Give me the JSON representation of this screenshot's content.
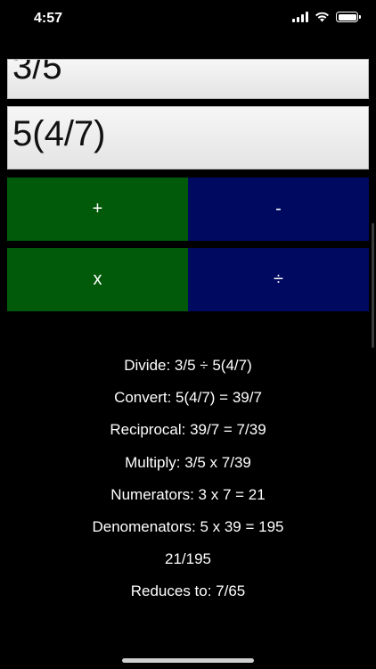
{
  "status_bar": {
    "time": "4:57",
    "icons": [
      "signal-icon",
      "wifi-icon",
      "battery-icon"
    ]
  },
  "inputs": {
    "first_fraction": "3/5",
    "second_fraction": "5(4/7)"
  },
  "operations": {
    "add": "+",
    "subtract": "-",
    "multiply": "x",
    "divide": "÷"
  },
  "steps": [
    "Divide: 3/5 ÷ 5(4/7)",
    "Convert: 5(4/7) = 39/7",
    "Reciprocal: 39/7 = 7/39",
    "Multiply: 3/5 x 7/39",
    "Numerators: 3 x 7 = 21",
    "Denomenators: 5 x 39 = 195",
    "21/195",
    "Reduces to: 7/65"
  ],
  "colors": {
    "background": "#000000",
    "add_multiply_button": "#005a0a",
    "subtract_divide_button": "#000960",
    "text": "#ffffff"
  }
}
